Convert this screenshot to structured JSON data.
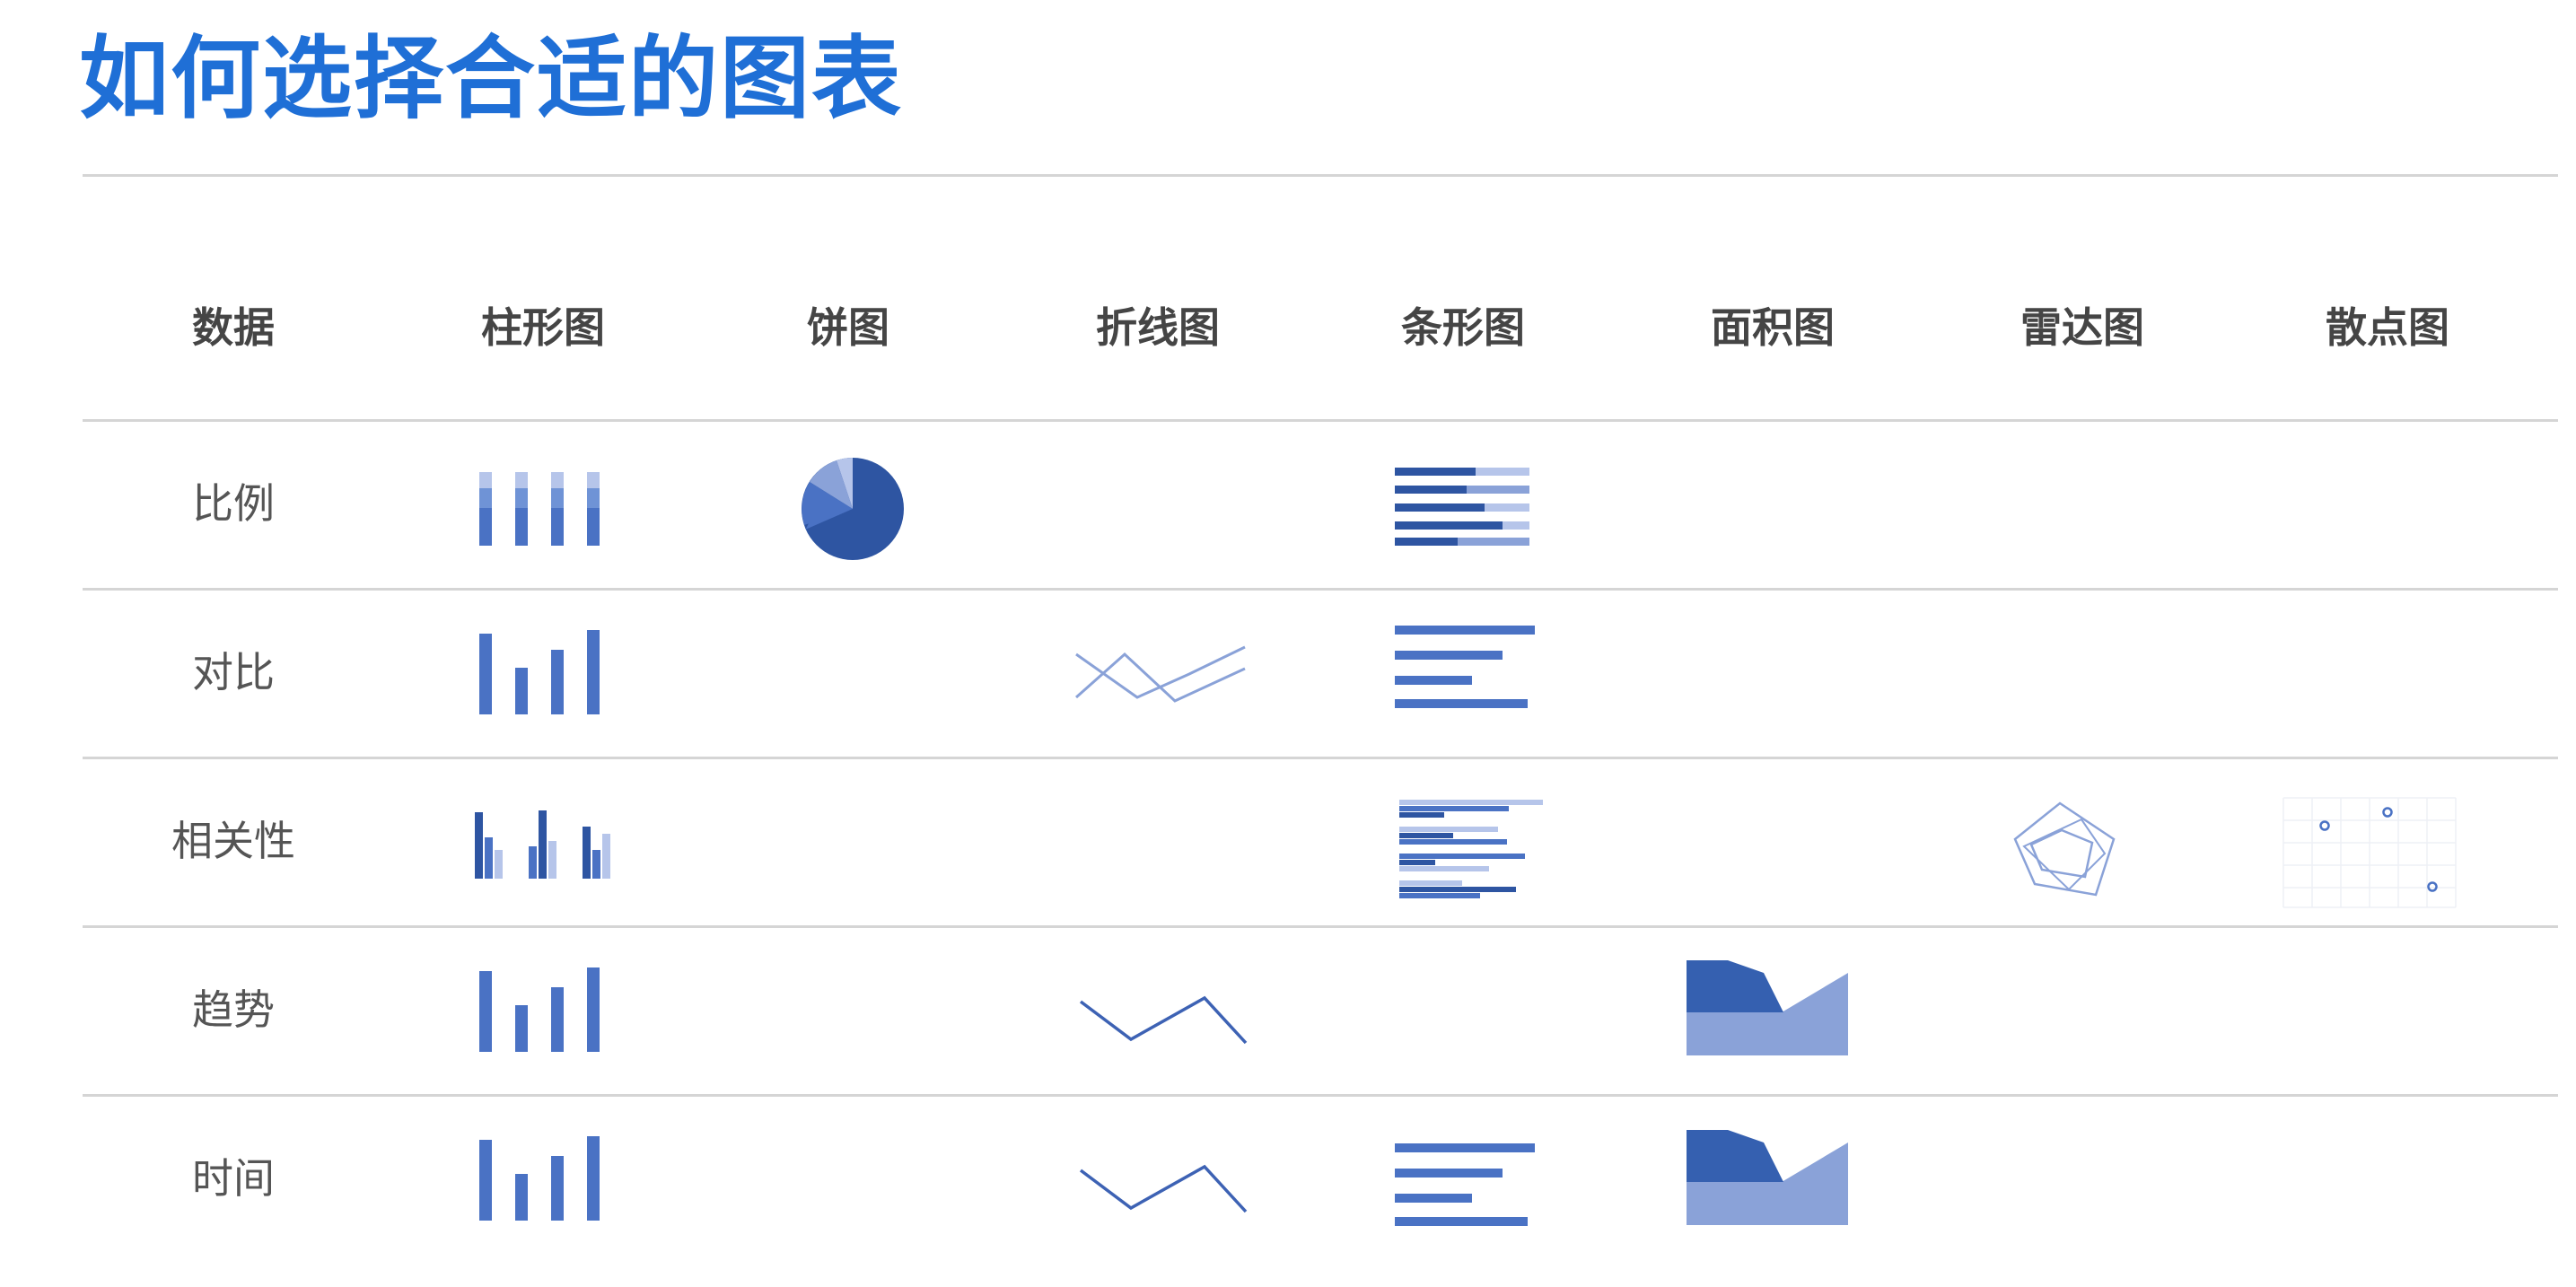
{
  "title": "如何选择合适的图表",
  "header": {
    "data_col": "数据",
    "columns": [
      "柱形图",
      "饼图",
      "折线图",
      "条形图",
      "面积图",
      "雷达图",
      "散点图"
    ]
  },
  "rows": [
    "比例",
    "对比",
    "相关性",
    "趋势",
    "时间"
  ],
  "colors": {
    "title": "#1f6fd6",
    "icon_dark": "#2e55a2",
    "icon_mid": "#4a72c4",
    "icon_light": "#8aa2d8",
    "icon_pale": "#b6c5ea"
  }
}
